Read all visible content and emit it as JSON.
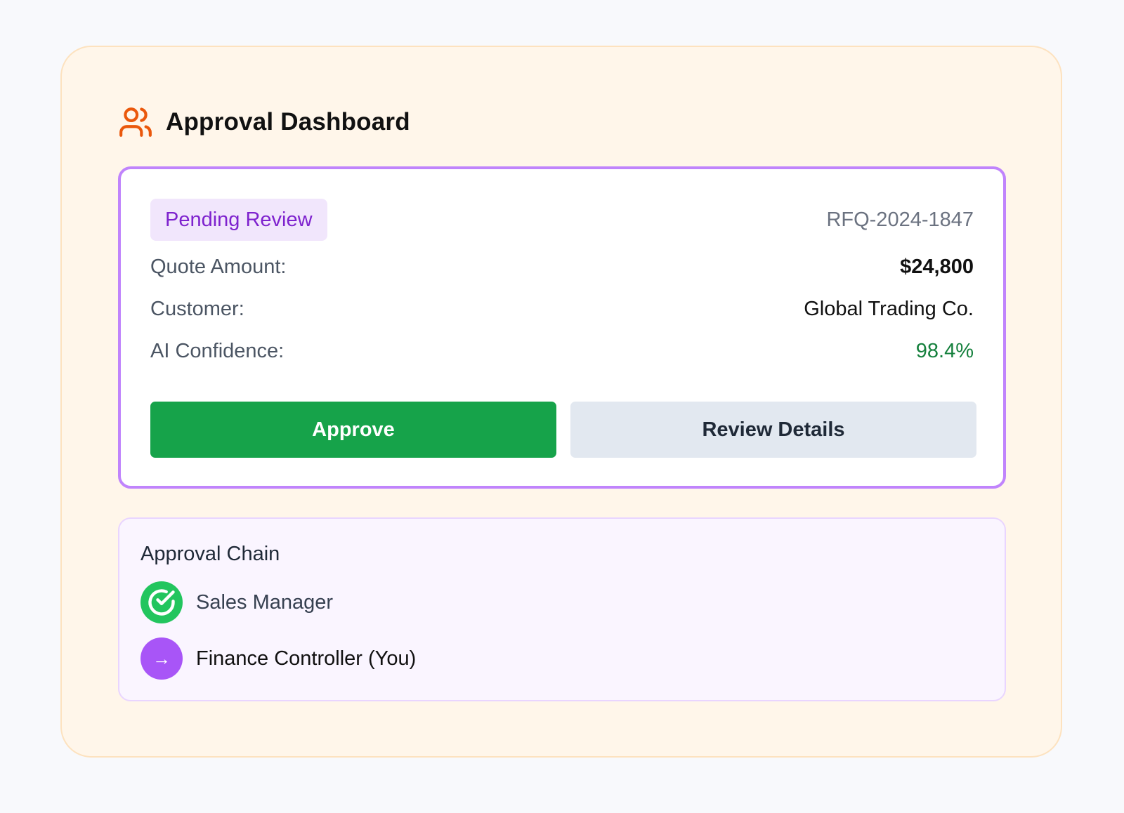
{
  "dashboard": {
    "title": "Approval Dashboard",
    "header_icon": "users-icon",
    "accent_color": "#ea580c"
  },
  "request": {
    "status": "Pending Review",
    "id": "RFQ-2024-1847",
    "fields": {
      "quote_amount_label": "Quote Amount:",
      "quote_amount": "$24,800",
      "customer_label": "Customer:",
      "customer": "Global Trading Co.",
      "confidence_label": "AI Confidence:",
      "confidence": "98.4%"
    },
    "actions": {
      "approve": "Approve",
      "review": "Review Details"
    },
    "border_color": "#c084fc"
  },
  "approval_chain": {
    "title": "Approval Chain",
    "steps": [
      {
        "name": "Sales Manager",
        "status": "completed",
        "icon": "check-circle-icon",
        "color": "#22c55e"
      },
      {
        "name": "Finance Controller (You)",
        "status": "current",
        "icon": "arrow-right-icon",
        "glyph": "→",
        "color": "#a855f7"
      }
    ]
  },
  "colors": {
    "approve_button": "#16a34a",
    "review_button": "#e2e8f0",
    "confidence_text": "#15803d",
    "badge_text": "#7e22ce"
  }
}
